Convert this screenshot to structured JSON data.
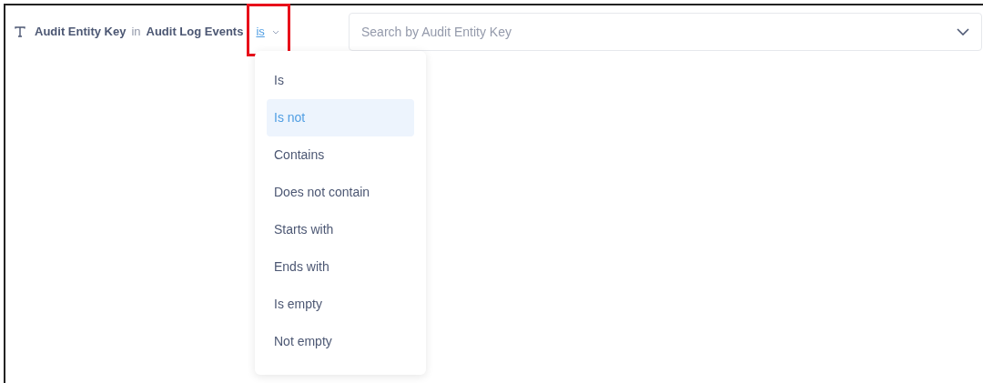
{
  "filter": {
    "field": "Audit Entity Key",
    "connector": "in",
    "table": "Audit Log Events",
    "operator": "is",
    "highlighted": true
  },
  "search": {
    "placeholder": "Search by Audit Entity Key"
  },
  "operator_menu": {
    "items": [
      {
        "label": "Is",
        "selected": false
      },
      {
        "label": "Is not",
        "selected": true
      },
      {
        "label": "Contains",
        "selected": false
      },
      {
        "label": "Does not contain",
        "selected": false
      },
      {
        "label": "Starts with",
        "selected": false
      },
      {
        "label": "Ends with",
        "selected": false
      },
      {
        "label": "Is empty",
        "selected": false
      },
      {
        "label": "Not empty",
        "selected": false
      }
    ]
  }
}
